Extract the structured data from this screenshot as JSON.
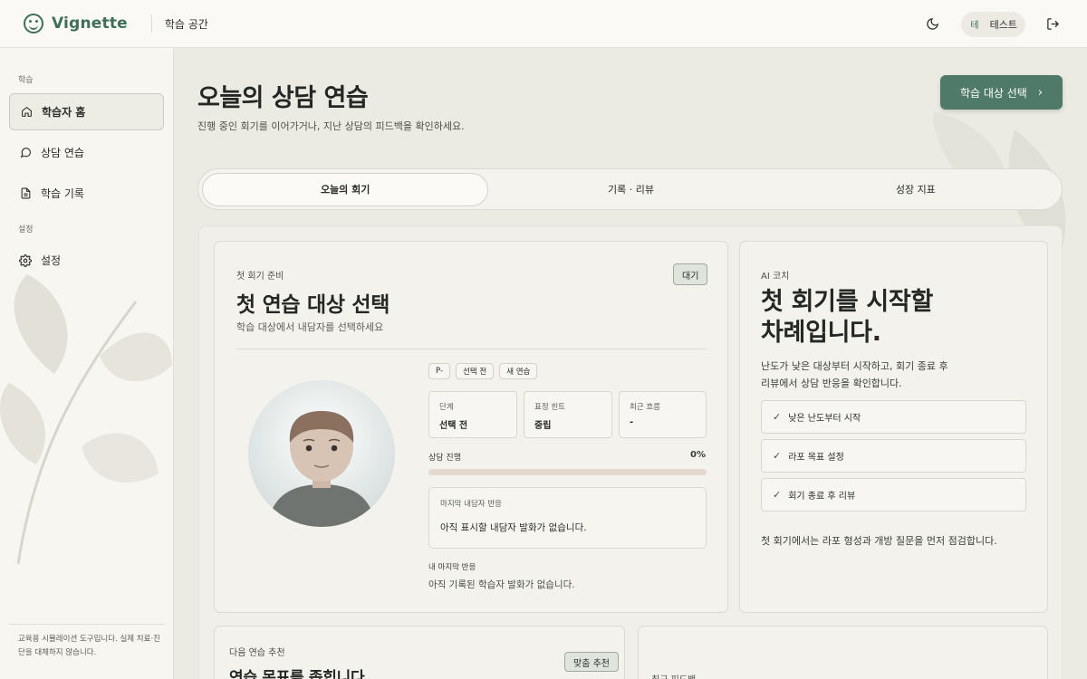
{
  "header": {
    "brand": "Vignette",
    "workspace": "학습 공간",
    "user_initial": "테",
    "user_name": "테스트"
  },
  "sidebar": {
    "section_learn": "학습",
    "section_settings": "설정",
    "items": [
      {
        "label": "학습자 홈",
        "icon": "home-icon",
        "active": true
      },
      {
        "label": "상담 연습",
        "icon": "chat-icon",
        "active": false
      },
      {
        "label": "학습 기록",
        "icon": "document-icon",
        "active": false
      },
      {
        "label": "설정",
        "icon": "gear-icon",
        "active": false
      }
    ],
    "disclaimer": "교육용 시뮬레이션 도구입니다. 실제 치료·진단을 대체하지 않습니다."
  },
  "page": {
    "title": "오늘의 상담 연습",
    "subtitle": "진행 중인 회기를 이어가거나, 지난 상담의 피드백을 확인하세요.",
    "cta_label": "학습 대상 선택"
  },
  "tabs": [
    {
      "label": "오늘의 회기",
      "active": true
    },
    {
      "label": "기록 · 리뷰",
      "active": false
    },
    {
      "label": "성장 지표",
      "active": false
    }
  ],
  "session_card": {
    "eyebrow": "첫 회기 준비",
    "title": "첫 연습 대상 선택",
    "subtitle": "학습 대상에서 내담자를 선택하세요",
    "status_badge": "대기",
    "chips": [
      "P-",
      "선택 전",
      "새 연습"
    ],
    "stats": [
      {
        "key": "단계",
        "value": "선택 전"
      },
      {
        "key": "표정 힌트",
        "value": "중립"
      },
      {
        "key": "최근 흐름",
        "value": "-"
      }
    ],
    "progress_label": "상담 진행",
    "progress_value": "0%",
    "progress_fraction": 0,
    "last_client_label": "마지막 내담자 반응",
    "last_client_value": "아직 표시할 내담자 발화가 없습니다.",
    "my_last_label": "내 마지막 반응",
    "my_last_value": "아직 기록된 학습자 발화가 없습니다."
  },
  "ai_card": {
    "eyebrow": "AI 코치",
    "title_line1": "첫 회기를 시작할",
    "title_line2": "차례입니다.",
    "desc": "난도가 낮은 대상부터 시작하고, 회기 종료 후 리뷰에서 상담 반응을 확인합니다.",
    "checklist": [
      "낮은 난도부터 시작",
      "라포 목표 설정",
      "회기 종료 후 리뷰"
    ],
    "footer": "첫 회기에서는 라포 형성과 개방 질문을 먼저 점검합니다."
  },
  "next_card": {
    "eyebrow": "다음 연습 추천",
    "title": "연습 목표를 좁힙니다.",
    "badge": "맞춤 추천"
  },
  "feedback_card": {
    "eyebrow": "최근 피드백"
  },
  "colors": {
    "accent": "#4f7a69",
    "brand": "#3f6f5c",
    "badge_bg": "#dfe5dd",
    "progress_track": "#e6d8cd"
  }
}
